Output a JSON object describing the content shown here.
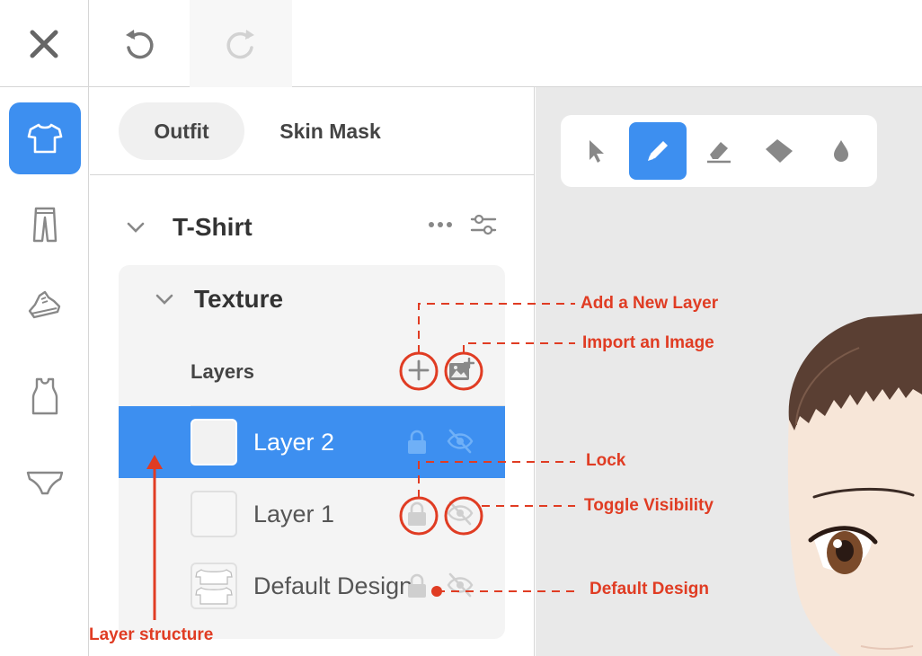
{
  "toolbar_top": {
    "close_icon": "close-icon",
    "undo_icon": "undo-icon",
    "redo_icon": "redo-icon"
  },
  "categories": [
    {
      "name": "t-shirt",
      "active": true
    },
    {
      "name": "pants",
      "active": false
    },
    {
      "name": "shoes",
      "active": false
    },
    {
      "name": "tank-top",
      "active": false
    },
    {
      "name": "underwear",
      "active": false
    }
  ],
  "tabs": {
    "outfit": "Outfit",
    "skin_mask": "Skin Mask"
  },
  "section": {
    "title": "T-Shirt"
  },
  "texture": {
    "title": "Texture",
    "layers_label": "Layers"
  },
  "layers": [
    {
      "name": "Layer 2",
      "selected": true
    },
    {
      "name": "Layer 1",
      "selected": false
    },
    {
      "name": "Default Design",
      "selected": false
    }
  ],
  "tools": [
    "select",
    "pen",
    "eraser",
    "fill",
    "dropper"
  ],
  "annotations": {
    "add_layer": "Add a New Layer",
    "import_image": "Import an Image",
    "lock": "Lock",
    "toggle_visibility": "Toggle Visibility",
    "default_design": "Default Design",
    "layer_structure": "Layer structure"
  },
  "colors": {
    "accent": "#3d8ff0",
    "annotation": "#e03c23"
  }
}
